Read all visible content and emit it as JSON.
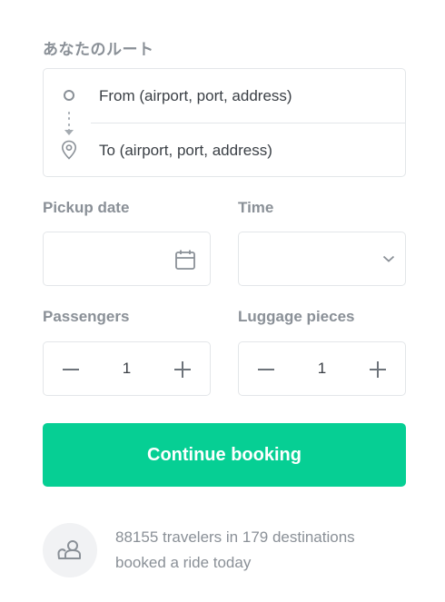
{
  "route": {
    "title": "あなたのルート",
    "from_placeholder": "From (airport, port, address)",
    "to_placeholder": "To (airport, port, address)"
  },
  "pickup": {
    "date_label": "Pickup date",
    "time_label": "Time"
  },
  "passengers": {
    "label": "Passengers",
    "value": "1"
  },
  "luggage": {
    "label": "Luggage pieces",
    "value": "1"
  },
  "actions": {
    "continue_label": "Continue booking"
  },
  "social_proof": {
    "line1": "88155 travelers in 179 destinations",
    "line2": "booked a ride today"
  },
  "colors": {
    "accent": "#06cf94",
    "muted_text": "#8a9097",
    "border": "#e3e6e9"
  },
  "icons": [
    "origin-dot-icon",
    "route-dots-icon",
    "location-pin-icon",
    "calendar-icon",
    "chevron-down-icon",
    "minus-icon",
    "plus-icon",
    "travelers-icon"
  ]
}
